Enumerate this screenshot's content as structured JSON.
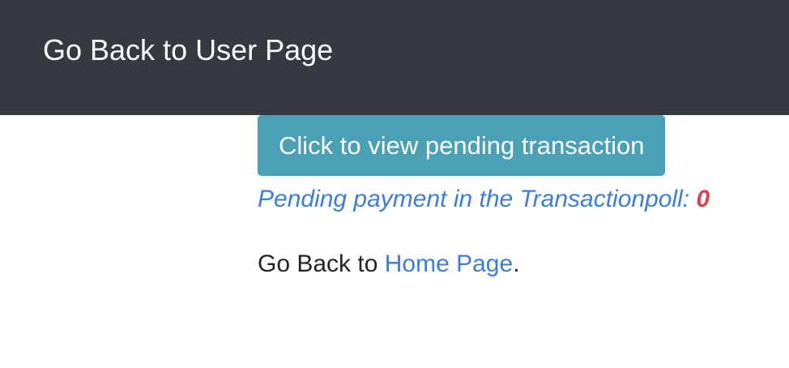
{
  "navbar": {
    "link_text": "Go Back to User Page"
  },
  "main": {
    "view_pending_button": "Click to view pending transaction",
    "pending_label": "Pending payment in the Transactionpoll: ",
    "pending_count": "0",
    "back_prefix": "Go Back to ",
    "home_link_text": "Home Page",
    "back_suffix": "."
  },
  "colors": {
    "navbar_bg": "#343a40",
    "button_bg": "#4aa0b5",
    "link": "#3b7ddd",
    "count": "#d9434b"
  }
}
